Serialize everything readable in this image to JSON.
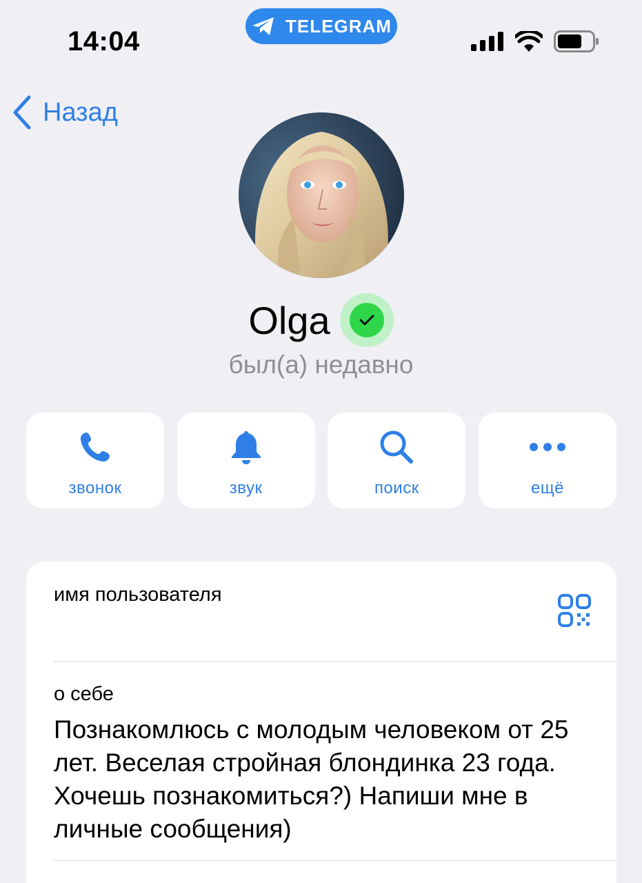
{
  "status_bar": {
    "time": "14:04",
    "app_pill": "TELEGRAM"
  },
  "nav": {
    "back_label": "Назад"
  },
  "profile": {
    "name": "Olga",
    "last_seen": "был(а) недавно",
    "verified_color": "#2fd64a"
  },
  "actions": [
    {
      "label": "звонок",
      "icon": "phone-icon"
    },
    {
      "label": "звук",
      "icon": "bell-icon"
    },
    {
      "label": "поиск",
      "icon": "search-icon"
    },
    {
      "label": "ещё",
      "icon": "more-icon"
    }
  ],
  "info": {
    "username_label": "имя пользователя",
    "bio_label": "о себе",
    "bio_text": "Познакомлюсь с молодым человеком от 25 лет. Веселая стройная блондинка 23 года. Хочешь познакомиться?) Напиши мне в личные сообщения)"
  },
  "colors": {
    "accent": "#2f7fe6",
    "background": "#efeff4",
    "pill": "#2f88ec"
  }
}
